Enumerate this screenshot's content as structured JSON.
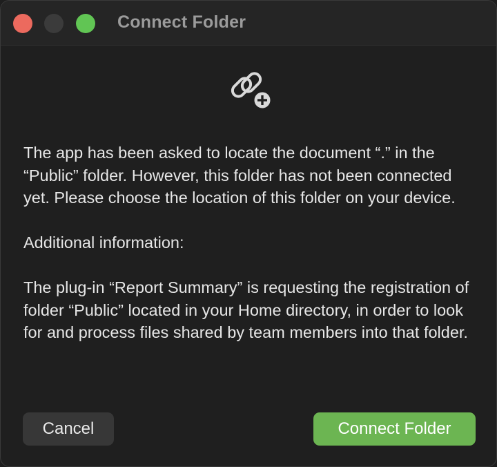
{
  "window": {
    "title": "Connect Folder"
  },
  "icon": {
    "name": "link-plus-icon"
  },
  "message": {
    "paragraph1": "The app has been asked to locate the document “.” in the “Public” folder. However, this folder has not been connected yet. Please choose the location of this folder on your device.",
    "paragraph2": "Additional information:",
    "paragraph3": "The plug-in “Report Summary” is requesting the registration of folder “Public” located in your Home directory, in order to look for and process files shared by team members into that folder."
  },
  "buttons": {
    "cancel_label": "Cancel",
    "connect_label": "Connect Folder"
  },
  "colors": {
    "accent": "#6cb552",
    "close": "#ec6a5e",
    "zoom": "#61c554"
  }
}
